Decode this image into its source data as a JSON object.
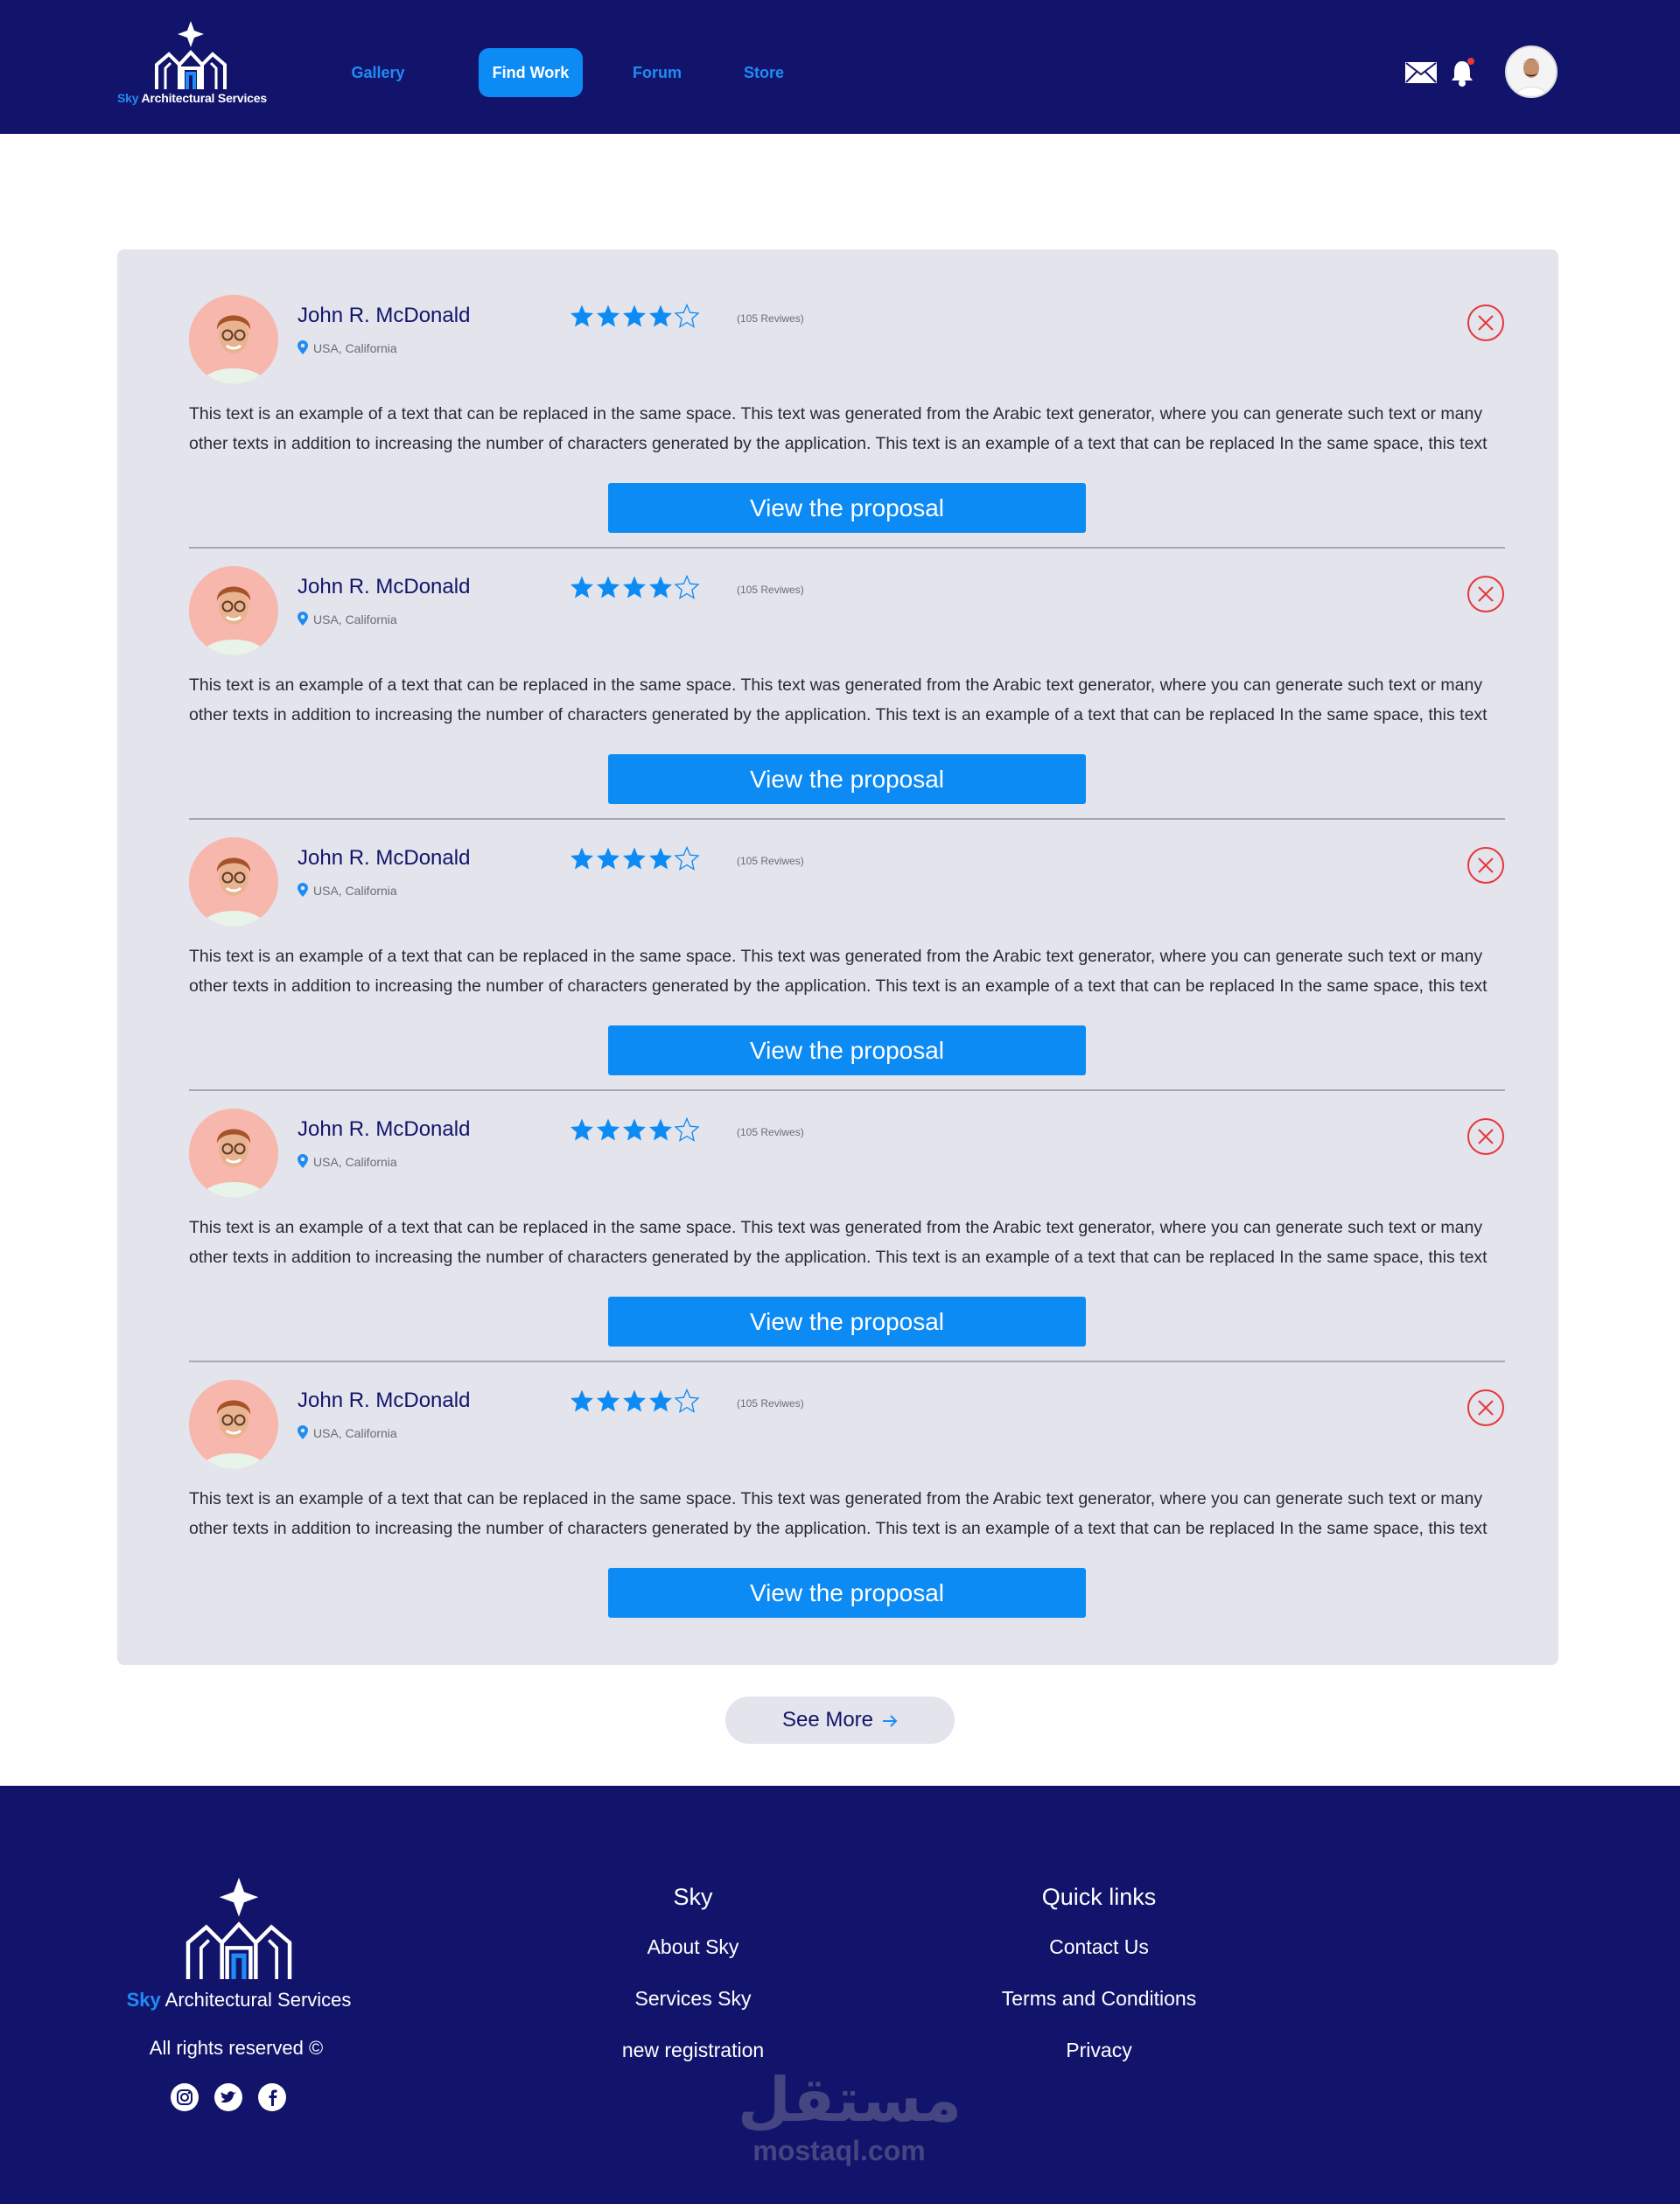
{
  "brand": {
    "accent": "#1f8cf5",
    "navy": "#12146b",
    "button_blue": "#0d8bf5",
    "panel_gray": "#e3e4ec",
    "close_red": "#e8363a",
    "logo_sky": "Sky",
    "logo_rest": "Architectural Services"
  },
  "header": {
    "nav": [
      {
        "label": "Gallery",
        "active": false
      },
      {
        "label": "Find Work",
        "active": true
      },
      {
        "label": "Forum",
        "active": false
      },
      {
        "label": "Store",
        "active": false
      }
    ],
    "icons": [
      "mail-icon",
      "notification-bell-icon"
    ],
    "notification_dot_color": "#e8363a"
  },
  "proposals": [
    {
      "name": "John R. McDonald",
      "location": "USA, California",
      "rating": 4,
      "rating_max": 5,
      "reviews": "(105 Reviwes)",
      "text_line_1": "This text is an example of a text that can be replaced in the same space. This text was generated from the Arabic text generator, where you can generate such text or many",
      "text_line_2": "other texts in addition to increasing the number of characters generated by the application. This text is an example of a text that can be replaced In the same space, this text",
      "button_label": "View the proposal"
    },
    {
      "name": "John R. McDonald",
      "location": "USA, California",
      "rating": 4,
      "rating_max": 5,
      "reviews": "(105 Reviwes)",
      "text_line_1": "This text is an example of a text that can be replaced in the same space. This text was generated from the Arabic text generator, where you can generate such text or many",
      "text_line_2": "other texts in addition to increasing the number of characters generated by the application. This text is an example of a text that can be replaced In the same space, this text",
      "button_label": "View the proposal"
    },
    {
      "name": "John R. McDonald",
      "location": "USA, California",
      "rating": 4,
      "rating_max": 5,
      "reviews": "(105 Reviwes)",
      "text_line_1": "This text is an example of a text that can be replaced in the same space. This text was generated from the Arabic text generator, where you can generate such text or many",
      "text_line_2": "other texts in addition to increasing the number of characters generated by the application. This text is an example of a text that can be replaced In the same space, this text",
      "button_label": "View the proposal"
    },
    {
      "name": "John R. McDonald",
      "location": "USA, California",
      "rating": 4,
      "rating_max": 5,
      "reviews": "(105 Reviwes)",
      "text_line_1": "This text is an example of a text that can be replaced in the same space. This text was generated from the Arabic text generator, where you can generate such text or many",
      "text_line_2": "other texts in addition to increasing the number of characters generated by the application. This text is an example of a text that can be replaced In the same space, this text",
      "button_label": "View the proposal"
    },
    {
      "name": "John R. McDonald",
      "location": "USA, California",
      "rating": 4,
      "rating_max": 5,
      "reviews": "(105 Reviwes)",
      "text_line_1": "This text is an example of a text that can be replaced in the same space. This text was generated from the Arabic text generator, where you can generate such text or many",
      "text_line_2": "other texts in addition to increasing the number of characters generated by the application. This text is an example of a text that can be replaced In the same space, this text",
      "button_label": "View the proposal"
    }
  ],
  "see_more": {
    "label": "See More"
  },
  "footer": {
    "rights": "All rights reserved ©",
    "social": [
      "instagram-icon",
      "twitter-icon",
      "facebook-icon"
    ],
    "col_sky": {
      "heading": "Sky",
      "links": [
        "About Sky",
        "Services Sky",
        "new registration"
      ]
    },
    "col_quick": {
      "heading": "Quick links",
      "links": [
        "Contact Us",
        "Terms and Conditions",
        "Privacy"
      ]
    },
    "watermark_ar": "مستقل",
    "watermark_latin": "mostaql.com"
  }
}
